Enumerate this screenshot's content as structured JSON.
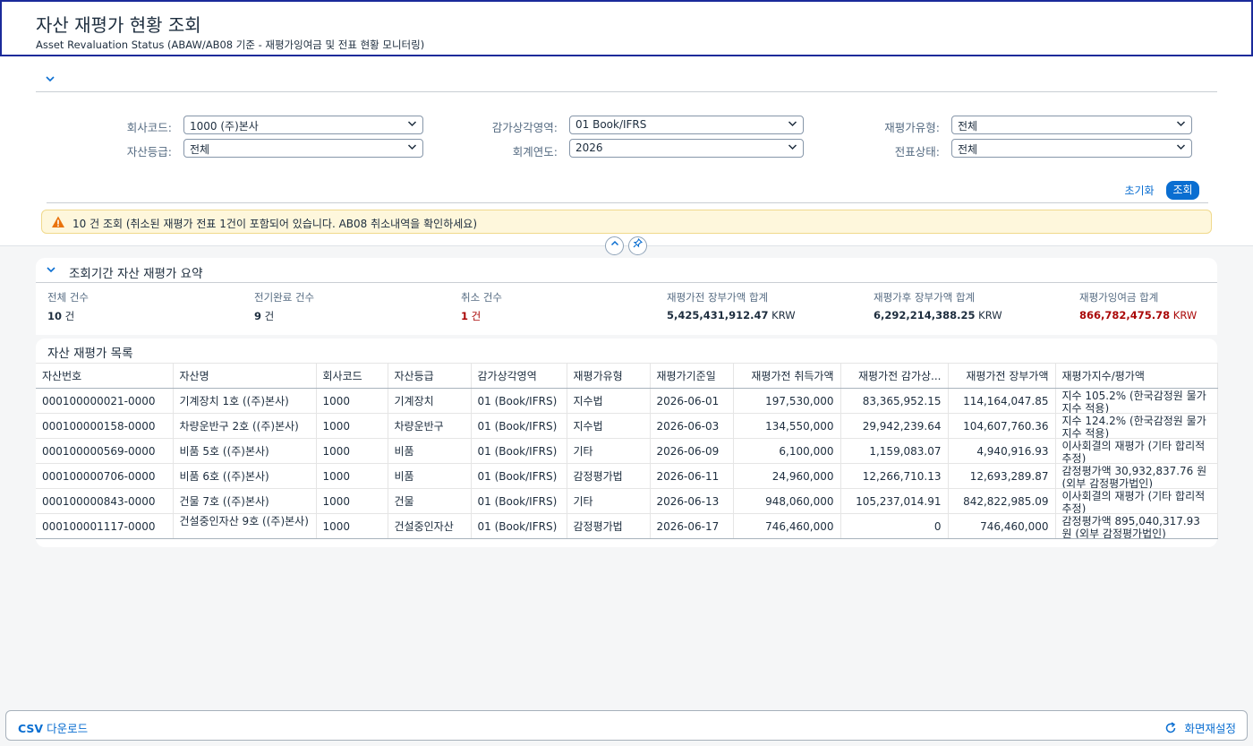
{
  "header": {
    "title": "자산 재평가 현황 조회",
    "subtitle": "Asset Revaluation Status (ABAW/AB08 기준 - 재평가잉여금 및 전표 현황 모니터링)"
  },
  "filters": {
    "company_label": "회사코드:",
    "company_value": "1000 (주)본사",
    "depr_area_label": "감가상각영역:",
    "depr_area_value": "01 Book/IFRS",
    "reval_type_label": "재평가유형:",
    "reval_type_value": "전체",
    "asset_class_label": "자산등급:",
    "asset_class_value": "전체",
    "fiscal_year_label": "회계연도:",
    "fiscal_year_value": "2026",
    "doc_status_label": "전표상태:",
    "doc_status_value": "전체",
    "reset_label": "초기화",
    "search_label": "조회"
  },
  "message": {
    "text": "10 건 조회 (취소된 재평가 전표 1건이 포함되어 있습니다. AB08 취소내역을 확인하세요)",
    "color": "#e9730c"
  },
  "summary": {
    "title": "조회기간 자산 재평가 요약",
    "kpis": [
      {
        "label": "전체 건수",
        "value": "10",
        "unit": " 건"
      },
      {
        "label": "전기완료 건수",
        "value": "9",
        "unit": " 건"
      },
      {
        "label": "취소 건수",
        "value": "1",
        "unit": " 건"
      },
      {
        "label": "재평가전 장부가액 합계",
        "value": "5,425,431,912.47",
        "unit": " KRW"
      },
      {
        "label": "재평가후 장부가액 합계",
        "value": "6,292,214,388.25",
        "unit": " KRW"
      },
      {
        "label": "재평가잉여금 합계",
        "value": "866,782,475.78",
        "unit": " KRW"
      }
    ],
    "negative_color": "#aa0808"
  },
  "list": {
    "title": "자산 재평가 목록",
    "columns": [
      "자산번호",
      "자산명",
      "회사코드",
      "자산등급",
      "감가상각영역",
      "재평가유형",
      "재평가기준일",
      "재평가전 취득가액",
      "재평가전 감가상...",
      "재평가전 장부가액",
      "재평가지수/평가액"
    ],
    "rows": [
      [
        "000100000021-0000",
        "기계장치 1호 ((주)본사)",
        "1000",
        "기계장치",
        "01 (Book/IFRS)",
        "지수법",
        "2026-06-01",
        "197,530,000",
        "83,365,952.15",
        "114,164,047.85",
        "지수 105.2% (한국감정원 물가지수 적용)"
      ],
      [
        "000100000158-0000",
        "차량운반구 2호 ((주)본사)",
        "1000",
        "차량운반구",
        "01 (Book/IFRS)",
        "지수법",
        "2026-06-03",
        "134,550,000",
        "29,942,239.64",
        "104,607,760.36",
        "지수 124.2% (한국감정원 물가지수 적용)"
      ],
      [
        "000100000569-0000",
        "비품 5호 ((주)본사)",
        "1000",
        "비품",
        "01 (Book/IFRS)",
        "기타",
        "2026-06-09",
        "6,100,000",
        "1,159,083.07",
        "4,940,916.93",
        "이사회결의 재평가 (기타 합리적 추정)"
      ],
      [
        "000100000706-0000",
        "비품 6호 ((주)본사)",
        "1000",
        "비품",
        "01 (Book/IFRS)",
        "감정평가법",
        "2026-06-11",
        "24,960,000",
        "12,266,710.13",
        "12,693,289.87",
        "감정평가액 30,932,837.76 원 (외부 감정평가법인)"
      ],
      [
        "000100000843-0000",
        "건물 7호 ((주)본사)",
        "1000",
        "건물",
        "01 (Book/IFRS)",
        "기타",
        "2026-06-13",
        "948,060,000",
        "105,237,014.91",
        "842,822,985.09",
        "이사회결의 재평가 (기타 합리적 추정)"
      ],
      [
        "000100001117-0000",
        "건설중인자산 9호 ((주)본사)",
        "1000",
        "건설중인자산",
        "01 (Book/IFRS)",
        "감정평가법",
        "2026-06-17",
        "746,460,000",
        "0",
        "746,460,000",
        "감정평가액 895,040,317.93 원 (외부 감정평가법인)"
      ]
    ]
  },
  "footer": {
    "csv_label": "CSV 다운로드",
    "reset_label": "화면재설정"
  },
  "colors": {
    "accent": "#0a6ed1",
    "header_border": "#1a2a9a"
  }
}
